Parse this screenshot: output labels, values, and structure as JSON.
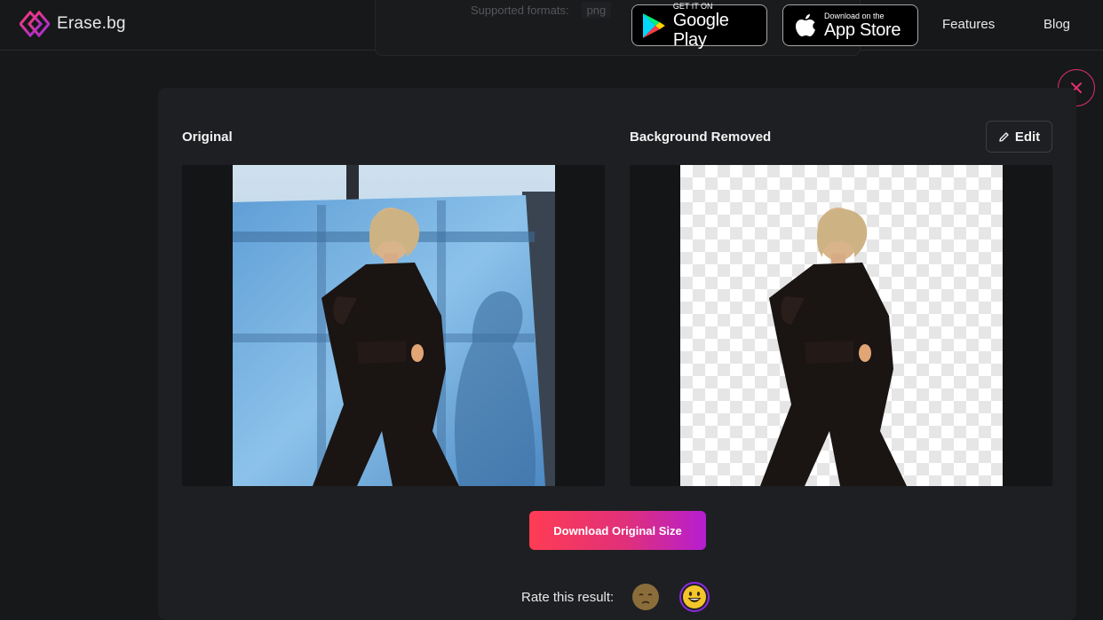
{
  "header": {
    "brand": "Erase.bg",
    "formats_label": "Supported formats:",
    "formats_value": "png",
    "google_play": {
      "small": "GET IT ON",
      "big": "Google Play"
    },
    "app_store": {
      "small": "Download on the",
      "big": "App Store"
    },
    "nav": [
      "Features",
      "Blog"
    ]
  },
  "result": {
    "original_label": "Original",
    "removed_label": "Background Removed",
    "edit_label": "Edit",
    "download_label": "Download Original Size",
    "rate_label": "Rate this result:",
    "rating_options": [
      "sad-face",
      "happy-face"
    ],
    "selected_rating": "happy-face"
  },
  "colors": {
    "accent": "#e0306e",
    "gradient_start": "#ff3c54",
    "gradient_end": "#b51ed0",
    "background": "#17181a"
  }
}
